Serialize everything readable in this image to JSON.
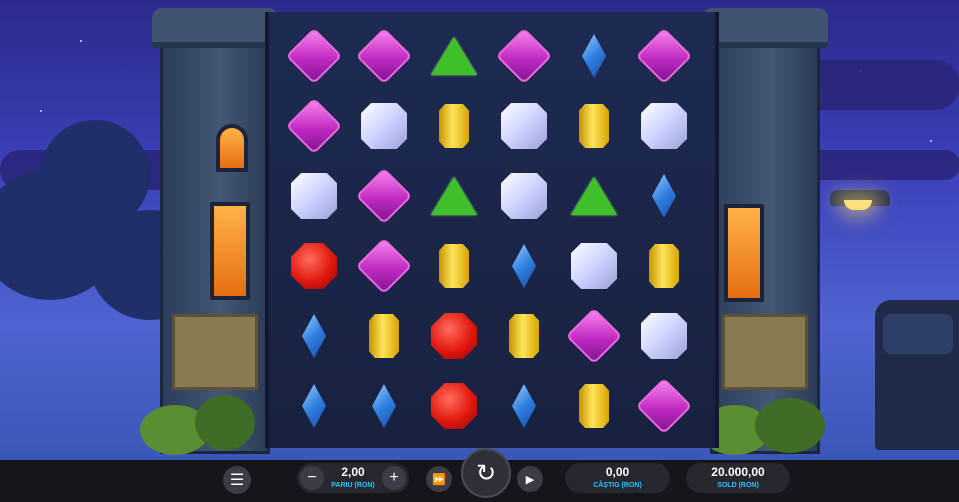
{
  "game": {
    "grid": [
      [
        "pink",
        "pink",
        "green",
        "pink",
        "blue",
        "pink"
      ],
      [
        "pink",
        "white",
        "yellow",
        "white",
        "yellow",
        "white"
      ],
      [
        "white",
        "pink",
        "green",
        "white",
        "green",
        "blue"
      ],
      [
        "red",
        "pink",
        "yellow",
        "blue",
        "white",
        "yellow"
      ],
      [
        "blue",
        "yellow",
        "red",
        "yellow",
        "pink",
        "white"
      ],
      [
        "blue",
        "blue",
        "red",
        "blue",
        "yellow",
        "pink"
      ]
    ]
  },
  "controls": {
    "menu_icon": "hamburger-icon",
    "bet": {
      "value": "2,00",
      "label": "PARIU (RON)"
    },
    "win": {
      "value": "0,00",
      "label": "CÂȘTIG (RON)"
    },
    "balance": {
      "value": "20.000,00",
      "label": "SOLD (RON)"
    },
    "spin_icon": "spin-refresh-icon",
    "turbo_icon": "fast-forward-icon",
    "autoplay_icon": "play-icon"
  },
  "colors": {
    "bar": "#14161c",
    "label_accent": "#2bc2ff"
  }
}
